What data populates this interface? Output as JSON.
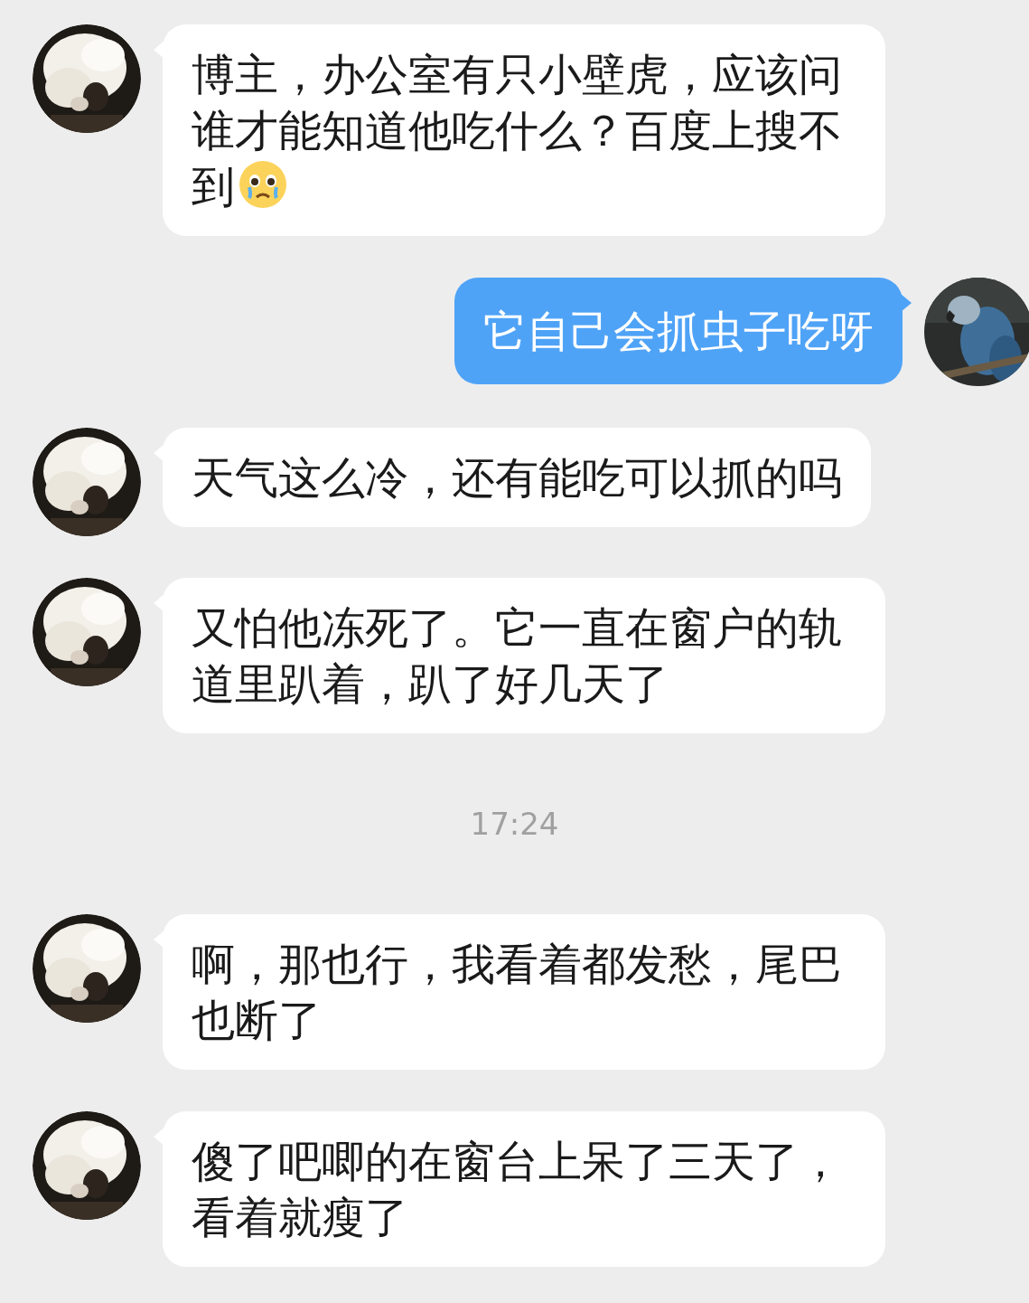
{
  "messages": [
    {
      "kind": "incoming",
      "text": "博主，办公室有只小壁虎，应该问谁才能知道他吃什么？百度上搜不到",
      "icons": [
        {
          "kind": "sad-face"
        }
      ]
    },
    {
      "kind": "outgoing",
      "text": "它自己会抓虫子吃呀"
    },
    {
      "kind": "incoming",
      "text": "天气这么冷，还有能吃可以抓的吗"
    },
    {
      "kind": "incoming",
      "text": "又怕他冻死了。它一直在窗户的轨道里趴着，趴了好几天了"
    },
    {
      "kind": "timestamp",
      "text": "17:24"
    },
    {
      "kind": "incoming",
      "text": "啊，那也行，我看着都发愁，尾巴也断了"
    },
    {
      "kind": "incoming",
      "text": "傻了吧唧的在窗台上呆了三天了，看着就瘦了"
    }
  ]
}
